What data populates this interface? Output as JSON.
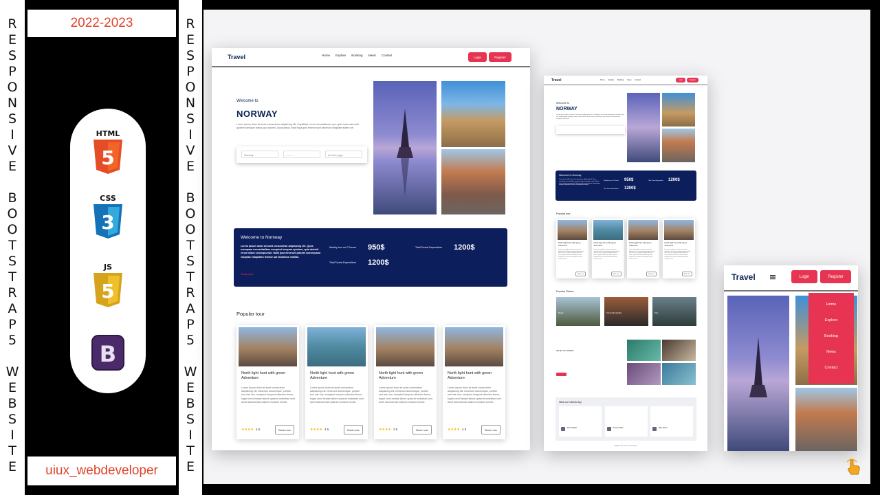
{
  "side_text": {
    "left": [
      "R",
      "E",
      "S",
      "P",
      "O",
      "N",
      "S",
      "I",
      "V",
      "E",
      "",
      "B",
      "O",
      "O",
      "T",
      "S",
      "T",
      "R",
      "A",
      "P",
      "5",
      "",
      "W",
      "E",
      "B",
      "S",
      "I",
      "T",
      "E"
    ],
    "right": [
      "R",
      "E",
      "S",
      "P",
      "O",
      "N",
      "S",
      "I",
      "V",
      "E",
      "",
      "B",
      "O",
      "O",
      "T",
      "S",
      "T",
      "R",
      "A",
      "P",
      "5",
      "",
      "W",
      "E",
      "B",
      "S",
      "I",
      "T",
      "E"
    ]
  },
  "year": "2022-2023",
  "username": "uiux_webdeveloper",
  "tech_icons": [
    "html5-logo",
    "css3-logo",
    "js-logo",
    "bootstrap-logo"
  ],
  "tech_labels": {
    "html": "HTML",
    "css": "CSS",
    "js": "JS"
  },
  "site": {
    "brand": "Travel",
    "nav": [
      "Home",
      "Explore",
      "Booking",
      "News",
      "Contact"
    ],
    "login": "Login",
    "register": "Register",
    "hero": {
      "welcome": "Welcome to",
      "title": "NORWAY",
      "text": "Lorem ipsum dolor sit amet consectetur adipisicing elit. Cupiditate, error exercitationem quo optio iusto nisi modi quidem similique minus quo dolores. Accusamus, modi fuga quis tenetur sunt deserunt voluptate autem vel.",
      "search_placeholder": "Norway",
      "time_placeholder": "--:-- --",
      "date_placeholder": "dd-mm-yyyy"
    },
    "band": {
      "title": "Welcome to Norrway",
      "text": "Lorem ipsum dolor sit amet consectetur adipisicing elit. Quos numquam necessitatibus excepturi tempora sportem, quia deleniti rerum ullam consequuntur. Nulla ipsa deserunt placeat consequatur voluptas voluptates tenetur aut doloribus mollitia.",
      "read_more": "Read more",
      "stat1_label": "Weekly tour on 2 Person",
      "stat1_value": "950$",
      "stat2_label": "Total Tourist Expenditure",
      "stat2_value": "1200$",
      "stat3_label": "Total Tourist Expenditure",
      "stat3_value": "1200$"
    },
    "popular_title": "Popular tour",
    "tours": [
      {
        "title": "North light hunt with green Adventure",
        "text": "Lorem ipsum dolor sit amet consectetur adipisicing elit. Deserunt doloremque, portitur rem iste non, excepturi tempora delectus ferum, fugiat omni beatae labore quaerat molestiae sunt amet assumenda nostrum incidunt omnis!",
        "rating": "4.5",
        "book": "Book now"
      },
      {
        "title": "North light hunt with green Adventure",
        "text": "Lorem ipsum dolor sit amet consectetur adipisicing elit. Deserunt doloremque, portitur rem iste non, excepturi tempora delectus ferum, fugiat omni beatae labore quaerat molestiae sunt amet assumenda nostrum incidunt omnis!",
        "rating": "4.5",
        "book": "Book now"
      },
      {
        "title": "North light hunt with green Adventure",
        "text": "Lorem ipsum dolor sit amet consectetur adipisicing elit. Deserunt doloremque, portitur rem iste non, excepturi tempora delectus ferum, fugiat omni beatae labore quaerat molestiae sunt amet assumenda nostrum incidunt omnis!",
        "rating": "3.5",
        "book": "Book now"
      },
      {
        "title": "North light hunt with green Adventure",
        "text": "Lorem ipsum dolor sit amet consectetur adipisicing elit. Deserunt doloremque, portitur rem iste non, excepturi tempora delectus ferum, fugiat omni beatae labore quaerat molestiae sunt amet assumenda nostrum incidunt omnis!",
        "rating": "4.5",
        "book": "Book now"
      }
    ],
    "popular_places_title": "Popular Places",
    "places": [
      "Bergen",
      "Tromso Municipality",
      "Oslo"
    ],
    "hotel_title": "HOTEL IN NORWAY",
    "clients_title": "What our Clients Say",
    "clients": [
      "Peter Schiller",
      "PCcerso Hilbe",
      "Mike Helmo"
    ],
    "footer": "copyright uiux@ 2022 uiux_webdeveloper"
  },
  "colors": {
    "navy": "#0d1e5c",
    "accent": "#e63452",
    "orange": "#e0442c"
  }
}
